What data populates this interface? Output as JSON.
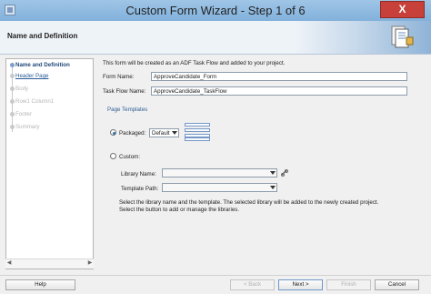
{
  "window": {
    "title": "Custom Form Wizard - Step 1 of 6",
    "close_glyph": "X"
  },
  "header": {
    "title": "Name and Definition"
  },
  "sidebar": {
    "steps": [
      {
        "label": "Name and Definition",
        "state": "current"
      },
      {
        "label": "Header Page",
        "state": "link"
      },
      {
        "label": "Body",
        "state": "disabled"
      },
      {
        "label": "Row1 Column1",
        "state": "disabled"
      },
      {
        "label": "Footer",
        "state": "disabled"
      },
      {
        "label": "Summary",
        "state": "disabled"
      }
    ]
  },
  "form": {
    "intro": "This form will be created as an ADF Task Flow and added to your project.",
    "form_name_label": "Form Name:",
    "form_name_value": "ApproveCandidate_Form",
    "task_flow_label": "Task Flow Name:",
    "task_flow_value": "ApproveCandidate_TaskFlow",
    "page_templates_label": "Page Templates",
    "packaged_label": "Packaged:",
    "packaged_value": "Default",
    "custom_label": "Custom:",
    "library_label": "Library Name:",
    "template_path_label": "Template Path:",
    "info_line1": "Select the library name and the template.  The selected library will be added to the newly created project.",
    "info_line2": "Select the button to add or manage the libraries."
  },
  "buttons": {
    "help": "Help",
    "back": "< Back",
    "next": "Next >",
    "finish": "Finish",
    "cancel": "Cancel"
  }
}
